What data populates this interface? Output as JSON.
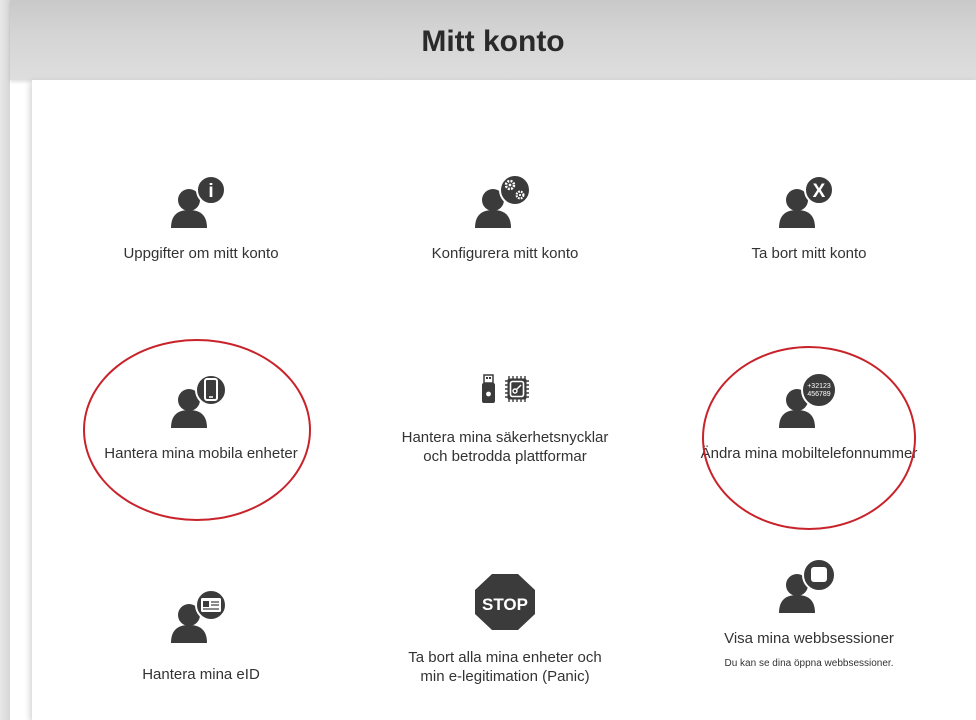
{
  "header": {
    "title": "Mitt konto"
  },
  "tiles": [
    {
      "label": "Uppgifter om mitt konto"
    },
    {
      "label": "Konfigurera mitt konto"
    },
    {
      "label": "Ta bort mitt konto"
    },
    {
      "label": "Hantera mina mobila enheter"
    },
    {
      "label": "Hantera mina säkerhetsnycklar och betrodda plattformar"
    },
    {
      "label": "Ändra mina mobiltelefonnummer",
      "badge_line1": "+32123",
      "badge_line2": "456789"
    },
    {
      "label": "Hantera mina eID"
    },
    {
      "label": "Ta bort alla mina enheter och min e-legitimation (Panic)",
      "badge": "STOP"
    },
    {
      "label": "Visa mina webbsessioner",
      "subtext": "Du kan se dina öppna webbsessioner."
    }
  ],
  "colors": {
    "icon": "#3b3b3b",
    "highlight": "#c8232a",
    "header_bg": "#d2d2d2"
  }
}
